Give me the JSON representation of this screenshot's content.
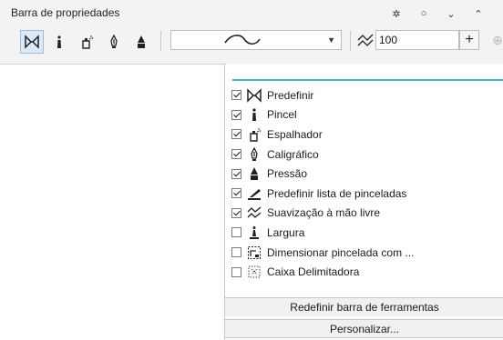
{
  "propbar": {
    "title": "Barra de propriedades",
    "window_controls": [
      {
        "name": "settings-icon",
        "glyph": "✲"
      },
      {
        "name": "options-icon",
        "glyph": "○"
      },
      {
        "name": "collapse-icon",
        "glyph": "⌄"
      },
      {
        "name": "expand-icon",
        "glyph": "⌃"
      },
      {
        "name": "close-icon",
        "glyph": "✕"
      }
    ],
    "tools": [
      {
        "name": "preset-tool",
        "icon": "preset-icon",
        "active": true
      },
      {
        "name": "brush-tool",
        "icon": "brush-icon"
      },
      {
        "name": "sprayer-tool",
        "icon": "sprayer-icon"
      },
      {
        "name": "calligraphic-tool",
        "icon": "calligraphic-icon"
      },
      {
        "name": "pressure-tool",
        "icon": "pressure-icon"
      }
    ],
    "stroke_dropdown_arrow": "▼",
    "smoothing_value": "100",
    "plus_label": "+",
    "plus_faded_label": "⊕"
  },
  "menu": {
    "accent_color": "#3fb2d8",
    "items": [
      {
        "label": "Predefinir",
        "checked": true,
        "icon": "preset-icon"
      },
      {
        "label": "Pincel",
        "checked": true,
        "icon": "brush-icon"
      },
      {
        "label": "Espalhador",
        "checked": true,
        "icon": "sprayer-icon"
      },
      {
        "label": "Caligráfico",
        "checked": true,
        "icon": "calligraphic-icon"
      },
      {
        "label": "Pressão",
        "checked": true,
        "icon": "pressure-icon"
      },
      {
        "label": "Predefinir lista de pinceladas",
        "checked": true,
        "icon": "stroke-list-icon"
      },
      {
        "label": "Suavização à mão livre",
        "checked": true,
        "icon": "smoothing-icon"
      },
      {
        "label": "Largura",
        "checked": false,
        "icon": "width-icon"
      },
      {
        "label": "Dimensionar pincelada com ...",
        "checked": false,
        "icon": "scale-stroke-icon"
      },
      {
        "label": "Caixa Delimitadora",
        "checked": false,
        "icon": "bounding-box-icon"
      }
    ],
    "reset_label": "Redefinir barra de ferramentas",
    "customize_label": "Personalizar..."
  }
}
